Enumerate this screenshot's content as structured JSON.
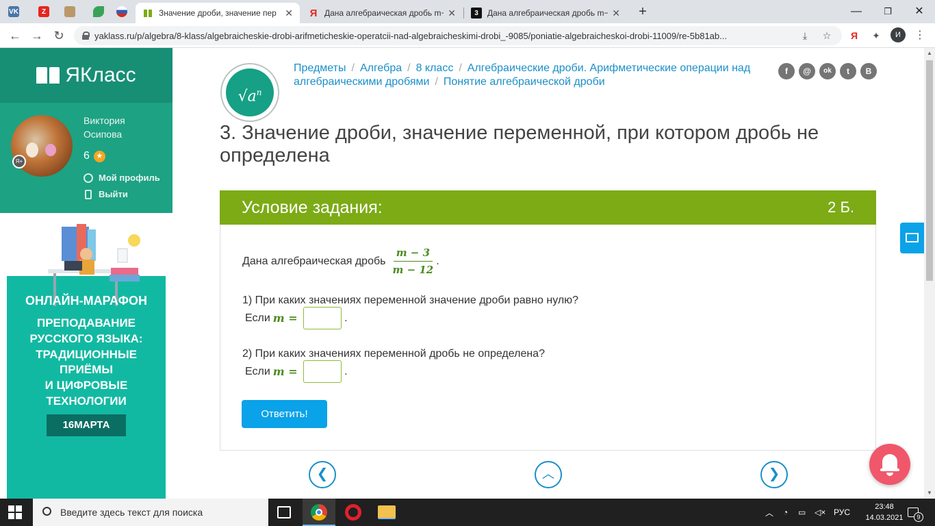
{
  "browser": {
    "pinned_tabs": [
      {
        "icon": "vk-icon",
        "label": "VK",
        "color": "#4a76a8"
      },
      {
        "icon": "z-icon",
        "label": "Z",
        "color": "#e52620"
      },
      {
        "icon": "photo-icon",
        "label": "",
        "color": "#b9986a"
      },
      {
        "icon": "leaf-icon",
        "label": "",
        "color": "#3aa35a"
      },
      {
        "icon": "flag-icon",
        "label": "",
        "color": "#2d5fb8"
      }
    ],
    "tabs": [
      {
        "title": "Значение дроби, значение пер",
        "icon": "yaklass-tab-icon",
        "active": true
      },
      {
        "title": "Дана алгебраическая дробь m−",
        "icon": "yandex-tab-icon",
        "active": false
      },
      {
        "title": "Дана алгебраическая дробь m−",
        "icon": "z-tab-icon",
        "active": false
      }
    ],
    "url": "yaklass.ru/p/algebra/8-klass/algebraicheskie-drobi-arifmeticheskie-operatcii-nad-algebraicheskimi-drobi_-9085/poniatie-algebraicheskoi-drobi-11009/re-5b81ab...",
    "profile_initial": "И"
  },
  "sidebar": {
    "logo_text": "ЯКласс",
    "user_name": "Виктория Осипова",
    "score": "6",
    "links": {
      "profile": "Мой профиль",
      "logout": "Выйти"
    }
  },
  "ad": {
    "title": "ОНЛАЙН-МАРАФОН",
    "body_lines": [
      "ПРЕПОДАВАНИЕ",
      "РУССКОГО ЯЗЫКА:",
      "ТРАДИЦИОННЫЕ",
      "ПРИЁМЫ",
      "И ЦИФРОВЫЕ",
      "ТЕХНОЛОГИИ"
    ],
    "date": "16МАРТА"
  },
  "breadcrumb": {
    "items": [
      "Предметы",
      "Алгебра",
      "8 класс",
      "Алгебраические дроби. Арифметические операции над алгебраическими дробями",
      "Понятие алгебраической дроби"
    ]
  },
  "social": [
    "f",
    "@",
    "ok",
    "t",
    "B"
  ],
  "page_title": "3. Значение дроби, значение переменной, при котором дробь не определена",
  "task": {
    "header": "Условие задания:",
    "points": "2 Б.",
    "intro": "Дана алгебраическая дробь",
    "fraction": {
      "numerator": "m − 3",
      "denominator": "m − 12"
    },
    "q1": "1) При каких значениях переменной значение дроби равно нулю?",
    "q2": "2) При каких значениях переменной дробь не определена?",
    "if_label": "Если",
    "variable": "m =",
    "answer1": "",
    "answer2": "",
    "submit": "Ответить!"
  },
  "taskbar": {
    "search_placeholder": "Введите здесь текст для поиска",
    "lang": "РУС",
    "time": "23:48",
    "date": "14.03.2021",
    "notifications": "9"
  },
  "colors": {
    "brand": "#178f75",
    "task_header": "#7cab16",
    "link": "#1a8fc9",
    "button": "#0aa2e8"
  }
}
